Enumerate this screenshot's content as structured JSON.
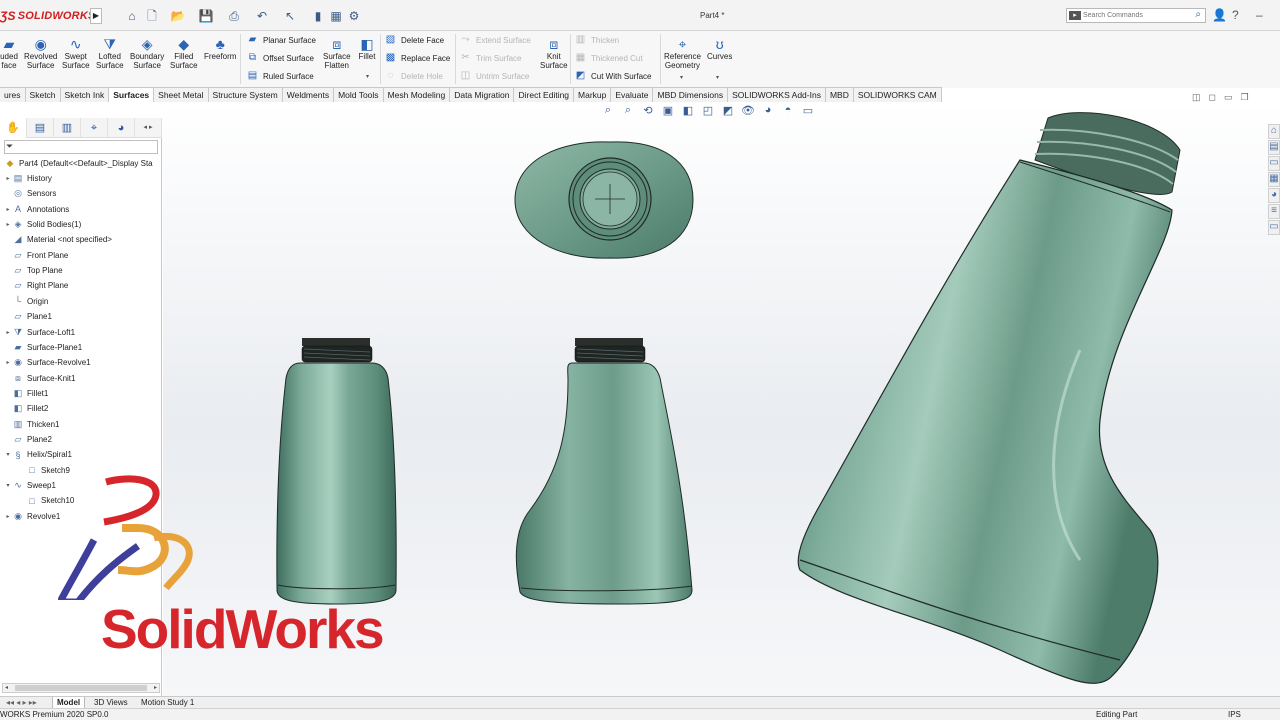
{
  "app": {
    "brand": "SOLIDWORKS",
    "document_title": "Part4 *",
    "search_placeholder": "Search Commands"
  },
  "quick_access": [
    "home-icon",
    "new-icon",
    "open-icon",
    "save-icon",
    "print-icon",
    "undo-icon",
    "select-icon",
    "rebuild-icon",
    "file-properties-icon",
    "options-icon"
  ],
  "command_manager": {
    "large_buttons": [
      {
        "id": "extruded-surface",
        "label": "uded\nface",
        "icon": "extruded-surface-icon",
        "glyph": "▰"
      },
      {
        "id": "revolved-surface",
        "label": "Revolved\nSurface",
        "icon": "revolved-surface-icon",
        "glyph": "◉"
      },
      {
        "id": "swept-surface",
        "label": "Swept\nSurface",
        "icon": "swept-surface-icon",
        "glyph": "∿"
      },
      {
        "id": "lofted-surface",
        "label": "Lofted\nSurface",
        "icon": "lofted-surface-icon",
        "glyph": "⧩"
      },
      {
        "id": "boundary-surface",
        "label": "Boundary\nSurface",
        "icon": "boundary-surface-icon",
        "glyph": "◈"
      },
      {
        "id": "filled-surface",
        "label": "Filled\nSurface",
        "icon": "filled-surface-icon",
        "glyph": "◆"
      },
      {
        "id": "freeform",
        "label": "Freeform",
        "icon": "freeform-icon",
        "glyph": "♣"
      }
    ],
    "group1": [
      {
        "id": "planar-surface",
        "label": "Planar Surface",
        "icon": "planar-surface-icon",
        "glyph": "▰",
        "enabled": true
      },
      {
        "id": "offset-surface",
        "label": "Offset Surface",
        "icon": "offset-surface-icon",
        "glyph": "⧉",
        "enabled": true
      },
      {
        "id": "ruled-surface",
        "label": "Ruled Surface",
        "icon": "ruled-surface-icon",
        "glyph": "▤",
        "enabled": true
      }
    ],
    "surface_flatten": {
      "label": "Surface\nFlatten",
      "icon": "surface-flatten-icon",
      "glyph": "⧈"
    },
    "fillet": {
      "label": "Fillet",
      "icon": "fillet-icon",
      "glyph": "◧"
    },
    "group2": [
      {
        "id": "delete-face",
        "label": "Delete Face",
        "icon": "delete-face-icon",
        "glyph": "▧",
        "enabled": true
      },
      {
        "id": "replace-face",
        "label": "Replace Face",
        "icon": "replace-face-icon",
        "glyph": "▩",
        "enabled": true
      },
      {
        "id": "delete-hole",
        "label": "Delete Hole",
        "icon": "delete-hole-icon",
        "glyph": "◌",
        "enabled": false
      }
    ],
    "group3": [
      {
        "id": "extend-surface",
        "label": "Extend Surface",
        "icon": "extend-surface-icon",
        "glyph": "⤳",
        "enabled": false
      },
      {
        "id": "trim-surface",
        "label": "Trim Surface",
        "icon": "trim-surface-icon",
        "glyph": "✂",
        "enabled": false
      },
      {
        "id": "untrim-surface",
        "label": "Untrim Surface",
        "icon": "untrim-surface-icon",
        "glyph": "◫",
        "enabled": false
      }
    ],
    "knit_surface": {
      "label": "Knit\nSurface",
      "icon": "knit-surface-icon",
      "glyph": "⧈"
    },
    "group4": [
      {
        "id": "thicken",
        "label": "Thicken",
        "icon": "thicken-icon",
        "glyph": "▥",
        "enabled": false
      },
      {
        "id": "thickened-cut",
        "label": "Thickened Cut",
        "icon": "thickened-cut-icon",
        "glyph": "▦",
        "enabled": false
      },
      {
        "id": "cut-with-surface",
        "label": "Cut With Surface",
        "icon": "cut-with-surface-icon",
        "glyph": "◩",
        "enabled": true
      }
    ],
    "reference_geometry": {
      "label": "Reference\nGeometry",
      "icon": "reference-geometry-icon",
      "glyph": "⌖"
    },
    "curves": {
      "label": "Curves",
      "icon": "curves-icon",
      "glyph": "ʊ"
    }
  },
  "tabs": [
    {
      "label": "ures",
      "active": false
    },
    {
      "label": "Sketch",
      "active": false
    },
    {
      "label": "Sketch Ink",
      "active": false
    },
    {
      "label": "Surfaces",
      "active": true
    },
    {
      "label": "Sheet Metal",
      "active": false
    },
    {
      "label": "Structure System",
      "active": false
    },
    {
      "label": "Weldments",
      "active": false
    },
    {
      "label": "Mold Tools",
      "active": false
    },
    {
      "label": "Mesh Modeling",
      "active": false
    },
    {
      "label": "Data Migration",
      "active": false
    },
    {
      "label": "Direct Editing",
      "active": false
    },
    {
      "label": "Markup",
      "active": false
    },
    {
      "label": "Evaluate",
      "active": false
    },
    {
      "label": "MBD Dimensions",
      "active": false
    },
    {
      "label": "SOLIDWORKS Add-Ins",
      "active": false
    },
    {
      "label": "MBD",
      "active": false
    },
    {
      "label": "SOLIDWORKS CAM",
      "active": false
    }
  ],
  "feature_manager": {
    "root": "Part4  (Default<<Default>_Display Sta",
    "items": [
      {
        "label": "History",
        "icon": "history-icon",
        "glyph": "▤",
        "expandable": true,
        "indent": 0
      },
      {
        "label": "Sensors",
        "icon": "sensors-icon",
        "glyph": "◎",
        "expandable": false,
        "indent": 0
      },
      {
        "label": "Annotations",
        "icon": "annotations-icon",
        "glyph": "A",
        "expandable": true,
        "indent": 0
      },
      {
        "label": "Solid Bodies(1)",
        "icon": "solid-bodies-icon",
        "glyph": "◈",
        "expandable": true,
        "indent": 0
      },
      {
        "label": "Material <not specified>",
        "icon": "material-icon",
        "glyph": "◢",
        "expandable": false,
        "indent": 0
      },
      {
        "label": "Front Plane",
        "icon": "plane-icon",
        "glyph": "▱",
        "expandable": false,
        "indent": 0
      },
      {
        "label": "Top Plane",
        "icon": "plane-icon",
        "glyph": "▱",
        "expandable": false,
        "indent": 0
      },
      {
        "label": "Right Plane",
        "icon": "plane-icon",
        "glyph": "▱",
        "expandable": false,
        "indent": 0
      },
      {
        "label": "Origin",
        "icon": "origin-icon",
        "glyph": "└",
        "expandable": false,
        "indent": 0
      },
      {
        "label": "Plane1",
        "icon": "plane-icon",
        "glyph": "▱",
        "expandable": false,
        "indent": 0
      },
      {
        "label": "Surface-Loft1",
        "icon": "surface-loft-icon",
        "glyph": "⧩",
        "expandable": true,
        "indent": 0
      },
      {
        "label": "Surface-Plane1",
        "icon": "surface-plane-icon",
        "glyph": "▰",
        "expandable": false,
        "indent": 0
      },
      {
        "label": "Surface-Revolve1",
        "icon": "surface-revolve-icon",
        "glyph": "◉",
        "expandable": true,
        "indent": 0
      },
      {
        "label": "Surface-Knit1",
        "icon": "surface-knit-icon",
        "glyph": "⧈",
        "expandable": false,
        "indent": 0
      },
      {
        "label": "Fillet1",
        "icon": "fillet-icon",
        "glyph": "◧",
        "expandable": false,
        "indent": 0
      },
      {
        "label": "Fillet2",
        "icon": "fillet-icon",
        "glyph": "◧",
        "expandable": false,
        "indent": 0
      },
      {
        "label": "Thicken1",
        "icon": "thicken-icon",
        "glyph": "▥",
        "expandable": false,
        "indent": 0
      },
      {
        "label": "Plane2",
        "icon": "plane-icon",
        "glyph": "▱",
        "expandable": false,
        "indent": 0
      },
      {
        "label": "Helix/Spiral1",
        "icon": "helix-icon",
        "glyph": "§",
        "expandable": true,
        "expanded": true,
        "indent": 0
      },
      {
        "label": "Sketch9",
        "icon": "sketch-icon",
        "glyph": "□",
        "expandable": false,
        "indent": 1
      },
      {
        "label": "Sweep1",
        "icon": "sweep-icon",
        "glyph": "∿",
        "expandable": true,
        "expanded": true,
        "indent": 0
      },
      {
        "label": "Sketch10",
        "icon": "sketch-icon",
        "glyph": "□",
        "expandable": false,
        "indent": 1
      },
      {
        "label": "Revolve1",
        "icon": "revolve-icon",
        "glyph": "◉",
        "expandable": true,
        "indent": 0
      }
    ]
  },
  "watermark": {
    "text": "SolidWorks"
  },
  "bottom_tabs": [
    {
      "label": "Model",
      "active": true
    },
    {
      "label": "3D Views",
      "active": false
    },
    {
      "label": "Motion Study 1",
      "active": false
    }
  ],
  "status": {
    "left": "WORKS Premium 2020 SP0.0",
    "mode": "Editing Part",
    "units": "IPS"
  },
  "colors": {
    "bottle_body": "#6f9f8d",
    "bottle_highlight": "#b9dccd",
    "bottle_shadow": "#3d6b5c",
    "thread": "#2a2f2c",
    "brand_red": "#d6262c",
    "brand_orange": "#e8a23a",
    "brand_blue": "#3d3f9a"
  }
}
